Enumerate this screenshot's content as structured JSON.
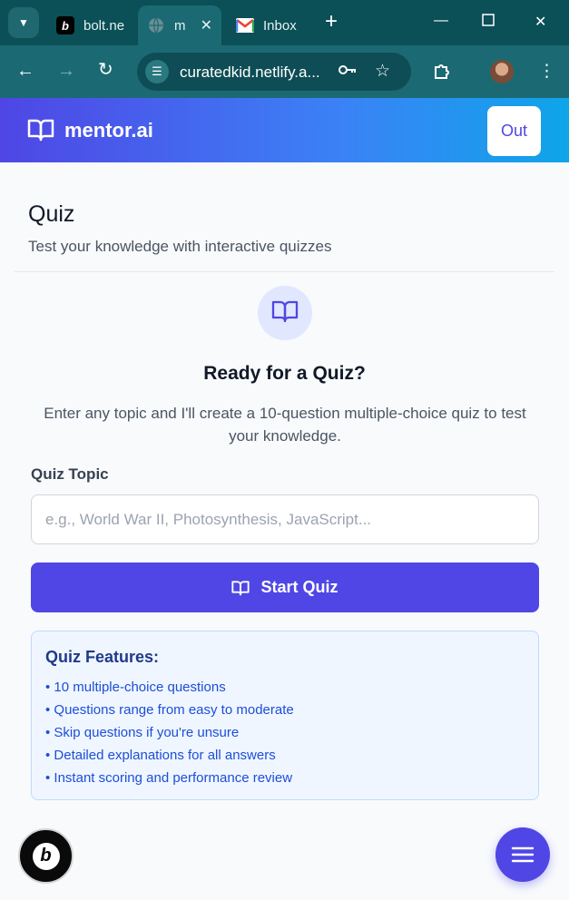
{
  "browser": {
    "tabs": [
      {
        "label": "bolt.ne",
        "favicon": "bolt-favicon"
      },
      {
        "label": "m",
        "favicon": "globe-favicon",
        "active": true
      },
      {
        "label": "Inbox",
        "favicon": "gmail-favicon"
      }
    ],
    "url": "curatedkid.netlify.a..."
  },
  "header": {
    "brand": "mentor.ai",
    "out_label": "Out"
  },
  "page": {
    "title": "Quiz",
    "subtitle": "Test your knowledge with interactive quizzes",
    "ready_heading": "Ready for a Quiz?",
    "description": "Enter any topic and I'll create a 10-question multiple-choice quiz to test your knowledge.",
    "topic_label": "Quiz Topic",
    "topic_placeholder": "e.g., World War II, Photosynthesis, JavaScript...",
    "topic_value": "",
    "start_label": "Start Quiz"
  },
  "features": {
    "title": "Quiz Features:",
    "items": [
      "• 10 multiple-choice questions",
      "• Questions range from easy to moderate",
      "• Skip questions if you're unsure",
      "• Detailed explanations for all answers",
      "• Instant scoring and performance review"
    ]
  },
  "colors": {
    "accent": "#4f46e5",
    "header_gradient_start": "#4f46e5",
    "header_gradient_end": "#0ea5e9",
    "features_bg": "#eff6ff",
    "chrome": "#0b4f57"
  }
}
